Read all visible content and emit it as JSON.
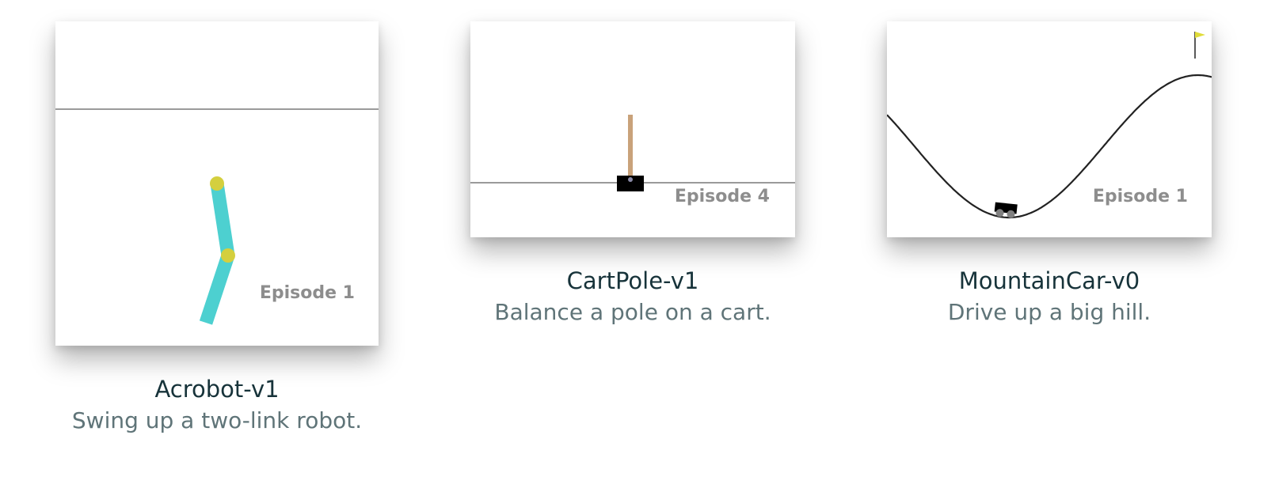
{
  "environments": [
    {
      "name": "Acrobot-v1",
      "description": "Swing up a two-link robot.",
      "episode": "Episode 1",
      "scene": "acrobot"
    },
    {
      "name": "CartPole-v1",
      "description": "Balance a pole on a cart.",
      "episode": "Episode 4",
      "scene": "cartpole"
    },
    {
      "name": "MountainCar-v0",
      "description": "Drive up a big hill.",
      "episode": "Episode 1",
      "scene": "mountaincar"
    }
  ],
  "colors": {
    "acrobot_link": "#4dd0d0",
    "acrobot_joint": "#d4cf3e",
    "pole": "#c9a27a",
    "cart": "#000000",
    "track": "#9a9a9a",
    "flag": "#e0dc3a",
    "episode_text": "#8d8d8d",
    "name_text": "#17333a",
    "desc_text": "#5f7478"
  }
}
